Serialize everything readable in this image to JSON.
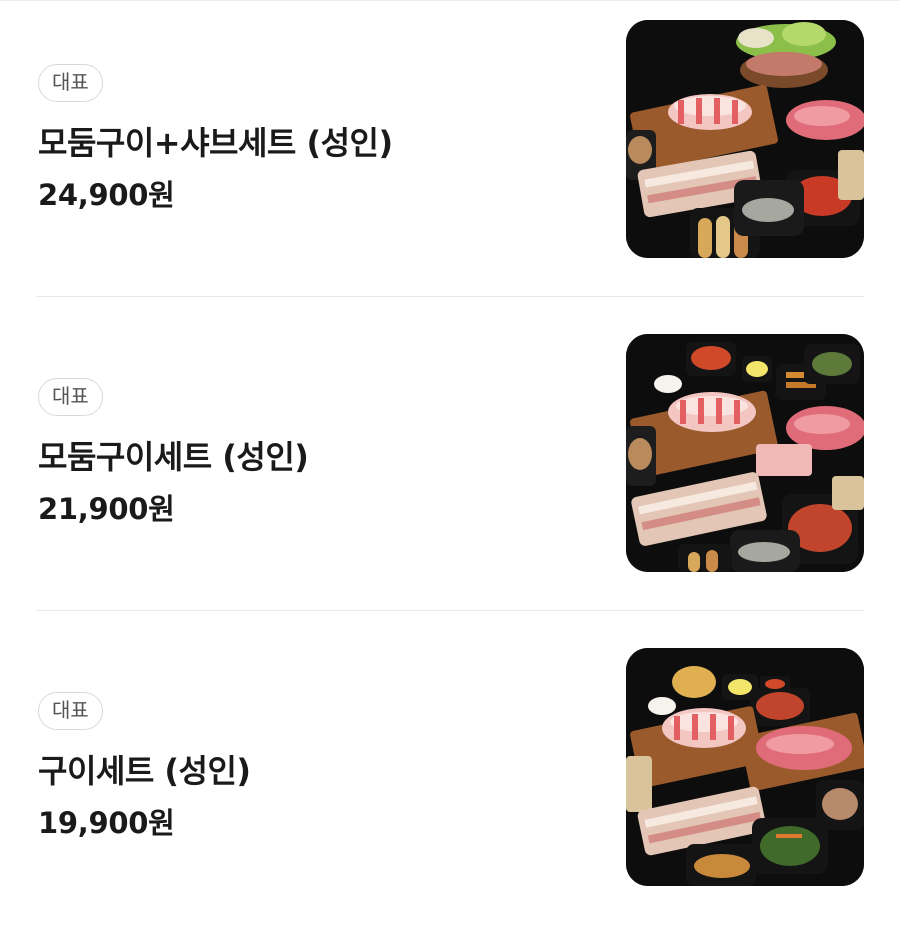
{
  "menu": {
    "items": [
      {
        "badge": "대표",
        "name": "모둠구이+샤브세트 (성인)",
        "price": "24,900원",
        "image": "bbq-meat-platter-with-shabu-pot"
      },
      {
        "badge": "대표",
        "name": "모둠구이세트 (성인)",
        "price": "21,900원",
        "image": "bbq-meat-platter-assorted"
      },
      {
        "badge": "대표",
        "name": "구이세트 (성인)",
        "price": "19,900원",
        "image": "bbq-meat-platter-grill"
      }
    ]
  },
  "colors": {
    "text": "#1a1a1a",
    "badge_border": "#d9d9d9",
    "badge_text": "#555555",
    "divider": "#e8e8e8",
    "photo_bg": "#0d0d0d"
  }
}
